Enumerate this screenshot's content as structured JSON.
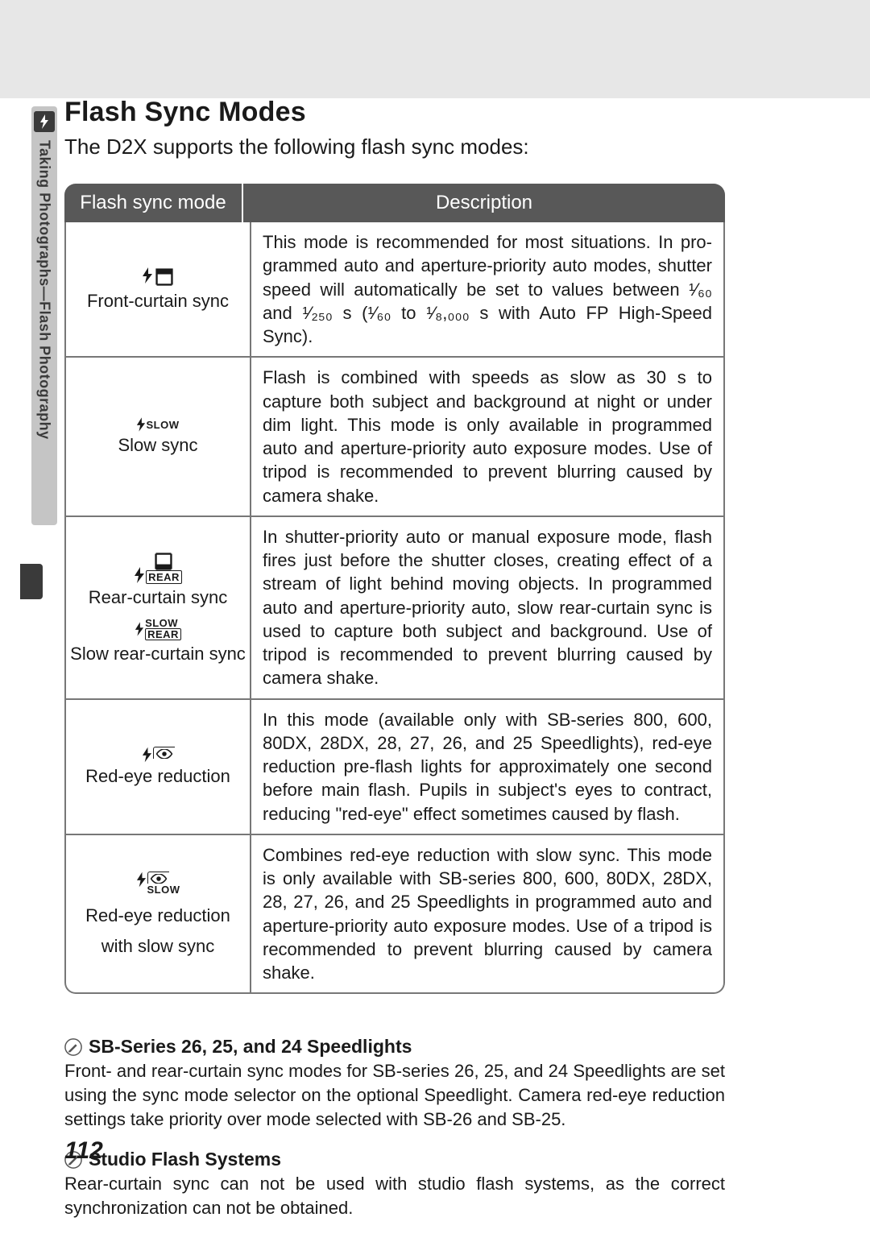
{
  "sidebar": {
    "section_label": "Taking Photographs—Flash Photography"
  },
  "heading": "Flash Sync Modes",
  "intro": "The D2X supports the following flash sync modes:",
  "table": {
    "head_mode": "Flash sync mode",
    "head_desc": "Description",
    "rows": [
      {
        "icons": [
          {
            "type": "front"
          }
        ],
        "labels": [
          "Front-curtain sync"
        ],
        "desc_html": "This mode is recommended for most situations.  In pro­grammed auto and aperture-priority auto modes, shutter speed will automatically be set to values between <span class='frac'>¹⁄₆₀</span> and <span class='frac'>¹⁄₂₅₀</span> s (<span class='frac'>¹⁄₆₀</span> to <span class='frac'>¹⁄₈,₀₀₀</span> s with Auto FP High-Speed Sync)."
      },
      {
        "icons": [
          {
            "type": "slow",
            "tag": "SLOW"
          }
        ],
        "labels": [
          "Slow sync"
        ],
        "desc": "Flash is combined with speeds as slow as 30 s to capture both subject and background at night or under dim light. This mode is only available in programmed auto and aper­ture-priority auto exposure modes.  Use of tripod is recom­mended to prevent blurring caused by camera shake."
      },
      {
        "icons": [
          {
            "type": "rear",
            "tag": "REAR"
          },
          {
            "type": "slowrear",
            "tag1": "SLOW",
            "tag2": "REAR"
          }
        ],
        "labels": [
          "Rear-curtain sync",
          "Slow rear-curtain sync"
        ],
        "desc": "In shutter-priority auto or manual exposure mode, flash fires just before the shutter closes, creating effect of a stream of light behind moving objects.  In programmed auto and aperture-priority auto, slow rear-curtain sync is used to cap­ture both subject and background.  Use of tripod is recom­mended to prevent blurring caused by camera shake."
      },
      {
        "icons": [
          {
            "type": "redeye"
          }
        ],
        "labels": [
          "Red-eye reduction"
        ],
        "desc": "In this mode (available only with SB-series 800, 600, 80DX, 28DX, 28, 27, 26, and 25 Speedlights), red-eye reduction pre-flash lights for approximately one second before main flash.  Pupils in subject's eyes to contract, reducing \"red-eye\" effect sometimes caused by flash."
      },
      {
        "icons": [
          {
            "type": "redeye-slow",
            "tag": "SLOW"
          }
        ],
        "labels": [
          "Red-eye reduction",
          "with slow sync"
        ],
        "desc": "Combines red-eye reduction with slow sync.  This mode is only available with SB-series 800, 600, 80DX, 28DX, 28, 27, 26, and 25 Speedlights in programmed auto and aperture-priority auto exposure modes.  Use of a tripod is recom­mended to prevent blurring caused by camera shake."
      }
    ]
  },
  "notes": [
    {
      "title": "SB-Series 26, 25, and 24 Speedlights",
      "body": "Front- and rear-curtain sync modes for SB-series 26, 25, and 24 Speedlights are set using the sync mode selector on the optional Speedlight.  Camera red-eye reduction settings take priority over mode selected with SB-26 and SB-25."
    },
    {
      "title": "Studio Flash Systems",
      "body": "Rear-curtain sync can not be used with studio flash systems, as the correct synchro­nization can not be obtained."
    }
  ],
  "page_number": "112"
}
